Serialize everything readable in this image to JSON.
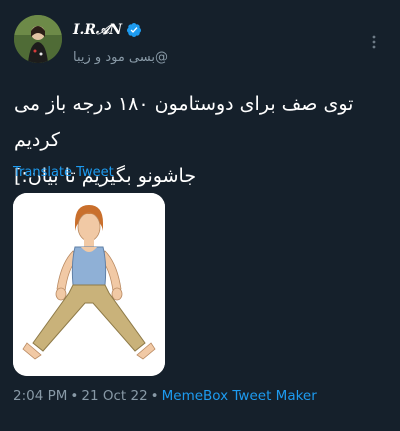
{
  "author": {
    "display_name": "I.R𝒜N",
    "handle": "بسی مود و زیبا@",
    "avatar_icon": "avatar-photo",
    "verified_icon": "verified-badge-icon",
    "verified_color": "#1d9bf0"
  },
  "tweet": {
    "lines": [
      "توی صف برای دوستامون ۱۸۰ درجه باز می کردیم",
      "جاشونو بگیریم تا بیان:]"
    ],
    "translate_label": "Translate Tweet",
    "media_icon": "cartoon-man-doing-splits-image"
  },
  "meta": {
    "time": "2:04 PM",
    "date": "21 Oct 22",
    "separator": "•",
    "source": "MemeBox Tweet Maker"
  },
  "colors": {
    "background": "#15202b",
    "link": "#1d9bf0",
    "secondary_text": "#8899a6"
  }
}
